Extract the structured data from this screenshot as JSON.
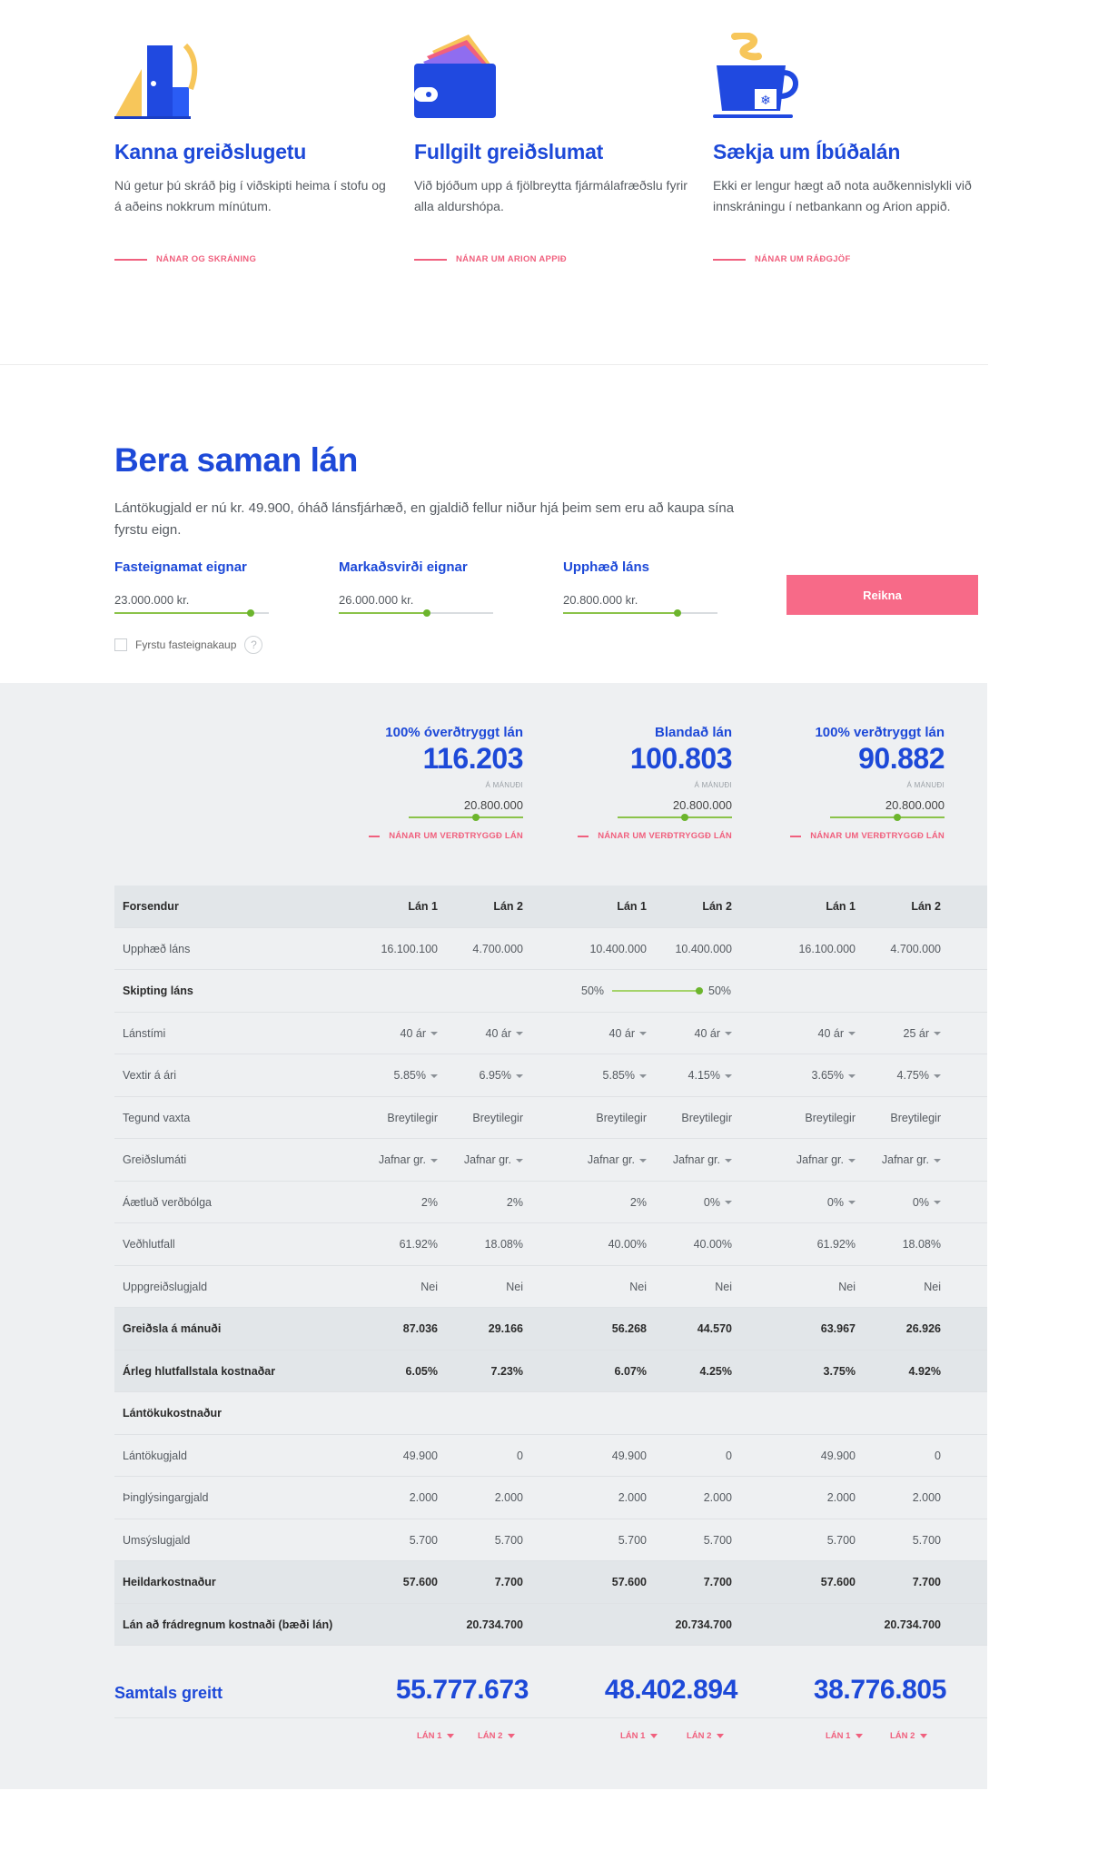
{
  "features": [
    {
      "title": "Kanna greiðslugetu",
      "text": "Nú getur þú skráð þig í viðskipti heima í stofu og á aðeins nokkrum mínútum.",
      "link": "NÁNAR OG SKRÁNING",
      "icon": "door-icon"
    },
    {
      "title": "Fullgilt greiðslumat",
      "text": "Við bjóðum upp á fjölbreytta fjármálafræðslu fyrir alla aldurshópa.",
      "link": "NÁNAR UM ARION APPIÐ",
      "icon": "wallet-icon"
    },
    {
      "title": "Sækja um Íbúðalán",
      "text": "Ekki er lengur hægt að nota auðkennislykli við innskráningu í netbankann og Arion appið.",
      "link": "NÁNAR UM RÁÐGJÖF",
      "icon": "coffee-cup-icon"
    }
  ],
  "compare": {
    "title": "Bera saman lán",
    "description": "Lántökugjald er nú kr. 49.900, óháð lánsfjárhæð, en gjaldið fellur niður hjá þeim sem eru að kaupa sína fyrstu eign.",
    "fields": [
      {
        "label": "Fasteignamat eignar",
        "value": "23.000.000 kr.",
        "level": 0.88
      },
      {
        "label": "Markaðsvirði eignar",
        "value": "26.000.000 kr.",
        "level": 0.57
      },
      {
        "label": "Upphæð láns",
        "value": "20.800.000 kr.",
        "level": 0.74
      }
    ],
    "button": "Reikna",
    "first_purchase": "Fyrstu fasteignakaup",
    "help": "?"
  },
  "columns": [
    {
      "name": "100% óverðtryggt lán",
      "monthly": "116.203",
      "per": "Á MÁNUÐI",
      "amount": "20.800.000",
      "link": "NÁNAR UM VERÐTRYGGÐ LÁN",
      "total": "55.777.673"
    },
    {
      "name": "Blandað lán",
      "monthly": "100.803",
      "per": "Á MÁNUÐI",
      "amount": "20.800.000",
      "link": "NÁNAR UM VERÐTRYGGÐ LÁN",
      "total": "48.402.894"
    },
    {
      "name": "100% verðtryggt lán",
      "monthly": "90.882",
      "per": "Á MÁNUÐI",
      "amount": "20.800.000",
      "link": "NÁNAR UM VERÐTRYGGÐ LÁN",
      "total": "38.776.805"
    }
  ],
  "table": {
    "header": {
      "label": "Forsendur",
      "cols": [
        "Lán 1",
        "Lán 2",
        "Lán 1",
        "Lán 2",
        "Lán 1",
        "Lán 2"
      ]
    },
    "rows": [
      {
        "label": "Upphæð láns",
        "vals": [
          "16.100.100",
          "4.700.000",
          "10.400.000",
          "10.400.000",
          "16.100.000",
          "4.700.000"
        ],
        "dd": [
          false,
          false,
          false,
          false,
          false,
          false
        ],
        "style": ""
      },
      {
        "label": "Skipting láns",
        "split": [
          "50%",
          "50%"
        ],
        "style": "bold-label"
      },
      {
        "label": "Lánstími",
        "vals": [
          "40 ár",
          "40 ár",
          "40 ár",
          "40 ár",
          "40 ár",
          "25 ár"
        ],
        "dd": [
          true,
          true,
          true,
          true,
          true,
          true
        ],
        "style": ""
      },
      {
        "label": "Vextir á ári",
        "vals": [
          "5.85%",
          "6.95%",
          "5.85%",
          "4.15%",
          "3.65%",
          "4.75%"
        ],
        "dd": [
          true,
          true,
          true,
          true,
          true,
          true
        ],
        "style": ""
      },
      {
        "label": "Tegund vaxta",
        "vals": [
          "Breytilegir",
          "Breytilegir",
          "Breytilegir",
          "Breytilegir",
          "Breytilegir",
          "Breytilegir"
        ],
        "dd": [
          false,
          false,
          false,
          false,
          false,
          false
        ],
        "style": ""
      },
      {
        "label": "Greiðslumáti",
        "vals": [
          "Jafnar gr.",
          "Jafnar gr.",
          "Jafnar gr.",
          "Jafnar gr.",
          "Jafnar gr.",
          "Jafnar gr."
        ],
        "dd": [
          true,
          true,
          true,
          true,
          true,
          true
        ],
        "style": ""
      },
      {
        "label": "Áætluð verðbólga",
        "vals": [
          "2%",
          "2%",
          "2%",
          "0%",
          "0%",
          "0%"
        ],
        "dd": [
          false,
          false,
          false,
          true,
          true,
          true
        ],
        "style": ""
      },
      {
        "label": "Veðhlutfall",
        "vals": [
          "61.92%",
          "18.08%",
          "40.00%",
          "40.00%",
          "61.92%",
          "18.08%"
        ],
        "dd": [
          false,
          false,
          false,
          false,
          false,
          false
        ],
        "style": ""
      },
      {
        "label": "Uppgreiðslugjald",
        "vals": [
          "Nei",
          "Nei",
          "Nei",
          "Nei",
          "Nei",
          "Nei"
        ],
        "dd": [
          false,
          false,
          false,
          false,
          false,
          false
        ],
        "style": ""
      },
      {
        "label": "Greiðsla á mánuði",
        "vals": [
          "87.036",
          "29.166",
          "56.268",
          "44.570",
          "63.967",
          "26.926"
        ],
        "dd": [
          false,
          false,
          false,
          false,
          false,
          false
        ],
        "style": "bold shaded"
      },
      {
        "label": "Árleg hlutfallstala kostnaðar",
        "vals": [
          "6.05%",
          "7.23%",
          "6.07%",
          "4.25%",
          "3.75%",
          "4.92%"
        ],
        "dd": [
          false,
          false,
          false,
          false,
          false,
          false
        ],
        "style": "bold shaded"
      },
      {
        "label": "Lántökukostnaður",
        "vals": [
          "",
          "",
          "",
          "",
          "",
          ""
        ],
        "dd": [
          false,
          false,
          false,
          false,
          false,
          false
        ],
        "style": "bold-label"
      },
      {
        "label": "Lántökugjald",
        "vals": [
          "49.900",
          "0",
          "49.900",
          "0",
          "49.900",
          "0"
        ],
        "dd": [
          false,
          false,
          false,
          false,
          false,
          false
        ],
        "style": ""
      },
      {
        "label": "Þinglýsingargjald",
        "vals": [
          "2.000",
          "2.000",
          "2.000",
          "2.000",
          "2.000",
          "2.000"
        ],
        "dd": [
          false,
          false,
          false,
          false,
          false,
          false
        ],
        "style": ""
      },
      {
        "label": "Umsýslugjald",
        "vals": [
          "5.700",
          "5.700",
          "5.700",
          "5.700",
          "5.700",
          "5.700"
        ],
        "dd": [
          false,
          false,
          false,
          false,
          false,
          false
        ],
        "style": ""
      },
      {
        "label": "Heildarkostnaður",
        "vals": [
          "57.600",
          "7.700",
          "57.600",
          "7.700",
          "57.600",
          "7.700"
        ],
        "dd": [
          false,
          false,
          false,
          false,
          false,
          false
        ],
        "style": "bold shaded"
      },
      {
        "label": "Lán að frádregnum kostnaði (bæði lán)",
        "vals": [
          "",
          "20.734.700",
          "",
          "20.734.700",
          "",
          "20.734.700"
        ],
        "dd": [
          false,
          false,
          false,
          false,
          false,
          false
        ],
        "style": "bold shaded"
      }
    ]
  },
  "total": {
    "label": "Samtals greitt"
  },
  "lan_links": [
    "LÁN 1",
    "LÁN 2",
    "LÁN 1",
    "LÁN 2",
    "LÁN 1",
    "LÁN 2"
  ],
  "colors": {
    "brand": "#1d49d8",
    "accent": "#f0607e",
    "button": "#f76a88",
    "slider": "#6cb52d"
  }
}
